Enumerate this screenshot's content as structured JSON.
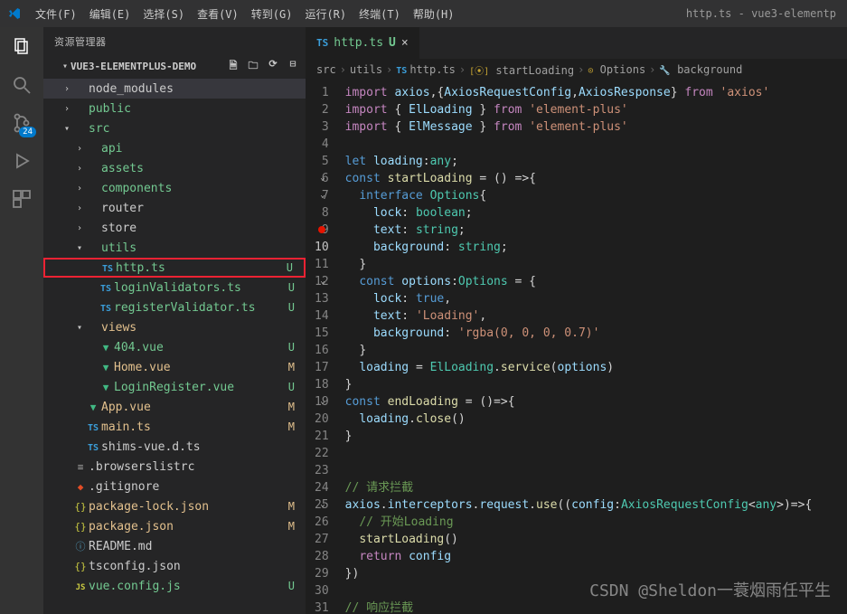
{
  "titlebar": {
    "menus": [
      "文件(F)",
      "编辑(E)",
      "选择(S)",
      "查看(V)",
      "转到(G)",
      "运行(R)",
      "终端(T)",
      "帮助(H)"
    ],
    "title": "http.ts - vue3-elementp"
  },
  "activity": {
    "badge": "24"
  },
  "sidebar": {
    "header": "资源管理器",
    "project": "VUE3-ELEMENTPLUS-DEMO",
    "tree": [
      {
        "type": "folder",
        "label": "node_modules",
        "indent": 1,
        "expanded": false,
        "color": "#cccccc",
        "selected": true
      },
      {
        "type": "folder",
        "label": "public",
        "indent": 1,
        "expanded": false,
        "color": "#73c991"
      },
      {
        "type": "folder",
        "label": "src",
        "indent": 1,
        "expanded": true,
        "color": "#73c991"
      },
      {
        "type": "folder",
        "label": "api",
        "indent": 2,
        "expanded": false,
        "color": "#73c991"
      },
      {
        "type": "folder",
        "label": "assets",
        "indent": 2,
        "expanded": false,
        "color": "#73c991"
      },
      {
        "type": "folder",
        "label": "components",
        "indent": 2,
        "expanded": false,
        "color": "#73c991"
      },
      {
        "type": "folder",
        "label": "router",
        "indent": 2,
        "expanded": false,
        "color": "#cccccc"
      },
      {
        "type": "folder",
        "label": "store",
        "indent": 2,
        "expanded": false,
        "color": "#cccccc"
      },
      {
        "type": "folder",
        "label": "utils",
        "indent": 2,
        "expanded": true,
        "color": "#73c991"
      },
      {
        "type": "file",
        "label": "http.ts",
        "indent": 3,
        "icon": "ts",
        "status": "U",
        "boxed": true,
        "color": "#73c991"
      },
      {
        "type": "file",
        "label": "loginValidators.ts",
        "indent": 3,
        "icon": "ts",
        "status": "U",
        "color": "#73c991"
      },
      {
        "type": "file",
        "label": "registerValidator.ts",
        "indent": 3,
        "icon": "ts",
        "status": "U",
        "color": "#73c991"
      },
      {
        "type": "folder",
        "label": "views",
        "indent": 2,
        "expanded": true,
        "color": "#e2c08d"
      },
      {
        "type": "file",
        "label": "404.vue",
        "indent": 3,
        "icon": "vue",
        "status": "U",
        "color": "#73c991"
      },
      {
        "type": "file",
        "label": "Home.vue",
        "indent": 3,
        "icon": "vue",
        "status": "M",
        "color": "#e2c08d"
      },
      {
        "type": "file",
        "label": "LoginRegister.vue",
        "indent": 3,
        "icon": "vue",
        "status": "U",
        "color": "#73c991"
      },
      {
        "type": "file",
        "label": "App.vue",
        "indent": 2,
        "icon": "vue",
        "status": "M",
        "color": "#e2c08d"
      },
      {
        "type": "file",
        "label": "main.ts",
        "indent": 2,
        "icon": "ts",
        "status": "M",
        "color": "#e2c08d"
      },
      {
        "type": "file",
        "label": "shims-vue.d.ts",
        "indent": 2,
        "icon": "ts",
        "color": "#cccccc"
      },
      {
        "type": "file",
        "label": ".browserslistrc",
        "indent": 1,
        "icon": "cfg",
        "color": "#cccccc"
      },
      {
        "type": "file",
        "label": ".gitignore",
        "indent": 1,
        "icon": "git",
        "color": "#cccccc"
      },
      {
        "type": "file",
        "label": "package-lock.json",
        "indent": 1,
        "icon": "json",
        "status": "M",
        "color": "#e2c08d"
      },
      {
        "type": "file",
        "label": "package.json",
        "indent": 1,
        "icon": "json",
        "status": "M",
        "color": "#e2c08d"
      },
      {
        "type": "file",
        "label": "README.md",
        "indent": 1,
        "icon": "md",
        "color": "#cccccc"
      },
      {
        "type": "file",
        "label": "tsconfig.json",
        "indent": 1,
        "icon": "json",
        "color": "#cccccc"
      },
      {
        "type": "file",
        "label": "vue.config.js",
        "indent": 1,
        "icon": "js",
        "status": "U",
        "color": "#73c991"
      }
    ]
  },
  "tab": {
    "label": "http.ts",
    "dirty": "U"
  },
  "breadcrumbs": [
    "src",
    "utils",
    "http.ts",
    "startLoading",
    "Options",
    "background"
  ],
  "code_lines": [
    {
      "n": 1,
      "html": "<span class='kw'>import</span> <span class='prop'>axios</span><span class='punct'>,{</span><span class='prop'>AxiosRequestConfig</span><span class='punct'>,</span><span class='prop'>AxiosResponse</span><span class='punct'>}</span> <span class='kw'>from</span> <span class='str'>'axios'</span>"
    },
    {
      "n": 2,
      "html": "<span class='kw'>import</span> <span class='punct'>{</span> <span class='prop'>ElLoading</span> <span class='punct'>}</span> <span class='kw'>from</span> <span class='str'>'element-plus'</span>"
    },
    {
      "n": 3,
      "html": "<span class='kw'>import</span> <span class='punct'>{</span> <span class='prop'>ElMessage</span> <span class='punct'>}</span> <span class='kw'>from</span> <span class='str'>'element-plus'</span>"
    },
    {
      "n": 4,
      "html": ""
    },
    {
      "n": 5,
      "html": "<span class='kw2'>let</span> <span class='prop'>loading</span><span class='punct'>:</span><span class='cls'>any</span><span class='punct'>;</span>"
    },
    {
      "n": 6,
      "fold": "v",
      "html": "<span class='kw2'>const</span> <span class='fn'>startLoading</span> <span class='punct'>= () =&gt;{</span>"
    },
    {
      "n": 7,
      "fold": "v",
      "html": "  <span class='kw2'>interface</span> <span class='cls'>Options</span><span class='punct'>{</span>"
    },
    {
      "n": 8,
      "html": "    <span class='prop'>lock</span><span class='punct'>:</span> <span class='cls'>boolean</span><span class='punct'>;</span>"
    },
    {
      "n": 9,
      "bp": true,
      "html": "    <span class='prop'>text</span><span class='punct'>:</span> <span class='cls'>string</span><span class='punct'>;</span>"
    },
    {
      "n": 10,
      "hl": true,
      "html": "    <span class='prop'>background</span><span class='punct'>:</span> <span class='cls'>string</span><span class='punct'>;</span>"
    },
    {
      "n": 11,
      "html": "  <span class='punct'>}</span>"
    },
    {
      "n": 12,
      "fold": "v",
      "html": "  <span class='kw2'>const</span> <span class='prop'>options</span><span class='punct'>:</span><span class='cls'>Options</span> <span class='punct'>= {</span>"
    },
    {
      "n": 13,
      "html": "    <span class='prop'>lock</span><span class='punct'>:</span> <span class='kw2'>true</span><span class='punct'>,</span>"
    },
    {
      "n": 14,
      "html": "    <span class='prop'>text</span><span class='punct'>:</span> <span class='str'>'Loading'</span><span class='punct'>,</span>"
    },
    {
      "n": 15,
      "html": "    <span class='prop'>background</span><span class='punct'>:</span> <span class='str'>'rgba(0, 0, 0, 0.7)'</span>"
    },
    {
      "n": 16,
      "html": "  <span class='punct'>}</span>"
    },
    {
      "n": 17,
      "html": "  <span class='prop'>loading</span> <span class='punct'>=</span> <span class='cls'>ElLoading</span><span class='punct'>.</span><span class='fn'>service</span><span class='punct'>(</span><span class='prop'>options</span><span class='punct'>)</span>"
    },
    {
      "n": 18,
      "html": "<span class='punct'>}</span>"
    },
    {
      "n": 19,
      "fold": "v",
      "html": "<span class='kw2'>const</span> <span class='fn'>endLoading</span> <span class='punct'>= ()=&gt;{</span>"
    },
    {
      "n": 20,
      "html": "  <span class='prop'>loading</span><span class='punct'>.</span><span class='fn'>close</span><span class='punct'>()</span>"
    },
    {
      "n": 21,
      "html": "<span class='punct'>}</span>"
    },
    {
      "n": 22,
      "html": ""
    },
    {
      "n": 23,
      "html": ""
    },
    {
      "n": 24,
      "html": "<span class='cmt'>// 请求拦截</span>"
    },
    {
      "n": 25,
      "fold": "v",
      "html": "<span class='prop'>axios</span><span class='punct'>.</span><span class='prop'>interceptors</span><span class='punct'>.</span><span class='prop'>request</span><span class='punct'>.</span><span class='fn'>use</span><span class='punct'>((</span><span class='prop'>config</span><span class='punct'>:</span><span class='cls'>AxiosRequestConfig</span><span class='punct'>&lt;</span><span class='cls'>any</span><span class='punct'>&gt;)=&gt;{</span>"
    },
    {
      "n": 26,
      "html": "  <span class='cmt'>// 开始Loading</span>"
    },
    {
      "n": 27,
      "html": "  <span class='fn'>startLoading</span><span class='punct'>()</span>"
    },
    {
      "n": 28,
      "html": "  <span class='kw'>return</span> <span class='prop'>config</span>"
    },
    {
      "n": 29,
      "html": "<span class='punct'>})</span>"
    },
    {
      "n": 30,
      "html": ""
    },
    {
      "n": 31,
      "html": "<span class='cmt'>// 响应拦截</span>"
    }
  ],
  "watermark": "CSDN @Sheldon一蓑烟雨任平生"
}
